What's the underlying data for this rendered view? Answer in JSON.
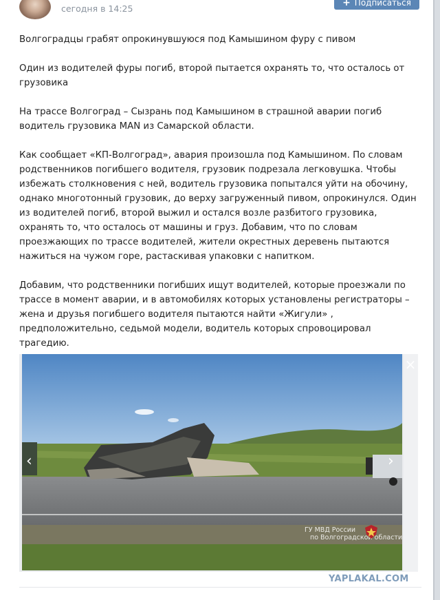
{
  "header": {
    "time": "сегодня в 14:25",
    "subscribe_label": "Подписаться"
  },
  "article": {
    "paragraphs": [
      "Волгоградцы грабят опрокинувшуюся под Камышином фуру с пивом",
      "Один из водителей фуры погиб, второй пытается охранять то, что осталось от грузовика",
      "На трассе Волгоград – Сызрань под Камышином в страшной аварии погиб водитель грузовика MAN из Самарской области.",
      "Как сообщает «КП-Волгоград», авария произошла под Камышином. По словам родственников погибшего водителя, грузовик подрезала легковушка. Чтобы избежать столкновения с ней, водитель грузовика попытался уйти на обочину, однако многотонный грузовик, до верху загруженный пивом, опрокинулся. Один из водителей погиб, второй выжил и остался возле разбитого грузовика, охранять то, что осталось от машины и груз. Добавим, что по словам проезжающих по трассе водителей, жители окрестных деревень пытаются нажиться на чужом горе, растаскивая упаковки с напитком.",
      "Добавим, что родственники погибших ищут водителей, которые проезжали по трассе в момент аварии, и в автомобилях которых установлены регистраторы – жена и друзья погибшего водителя пытаются найти «Жигули» , предположительно, седьмой модели, водитель которых спровоцировал трагедию."
    ]
  },
  "photo": {
    "watermark_line1": "ГУ МВД России",
    "watermark_line2": "по Волгоградской области",
    "close_glyph": "×",
    "prev_glyph": "‹",
    "next_glyph": "›"
  },
  "footer": {
    "site": "YAPLAKAL.COM"
  },
  "colors": {
    "accent": "#5b86b6",
    "time_text": "#8a939e",
    "site_mark": "#7f9cba"
  },
  "icons": {
    "subscribe": "plus-icon",
    "close": "close-icon",
    "prev": "chevron-left-icon",
    "next": "chevron-right-icon",
    "emblem": "police-emblem-icon"
  }
}
